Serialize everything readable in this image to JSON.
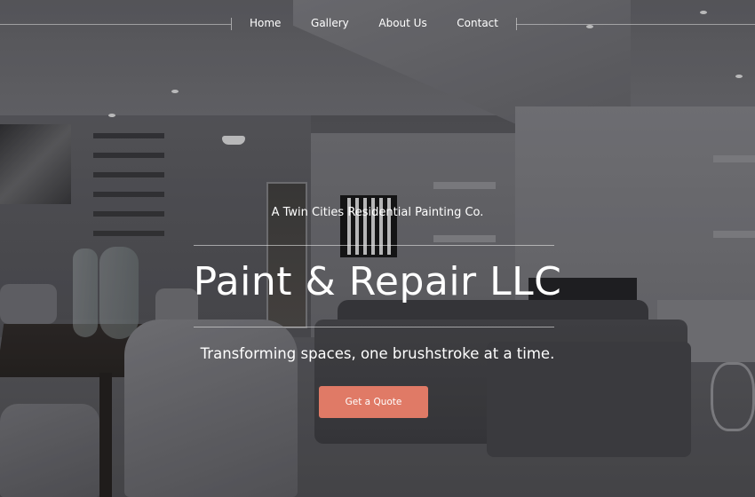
{
  "nav": {
    "links": [
      {
        "label": "Home"
      },
      {
        "label": "Gallery"
      },
      {
        "label": "About Us"
      },
      {
        "label": "Contact"
      }
    ]
  },
  "hero": {
    "tagline": "A Twin Cities Residential Painting Co.",
    "title": "Paint & Repair LLC",
    "subtitle": "Transforming spaces, one brushstroke at a time.",
    "cta_label": "Get a Quote"
  },
  "colors": {
    "accent": "#e07a66",
    "text": "#ffffff"
  }
}
